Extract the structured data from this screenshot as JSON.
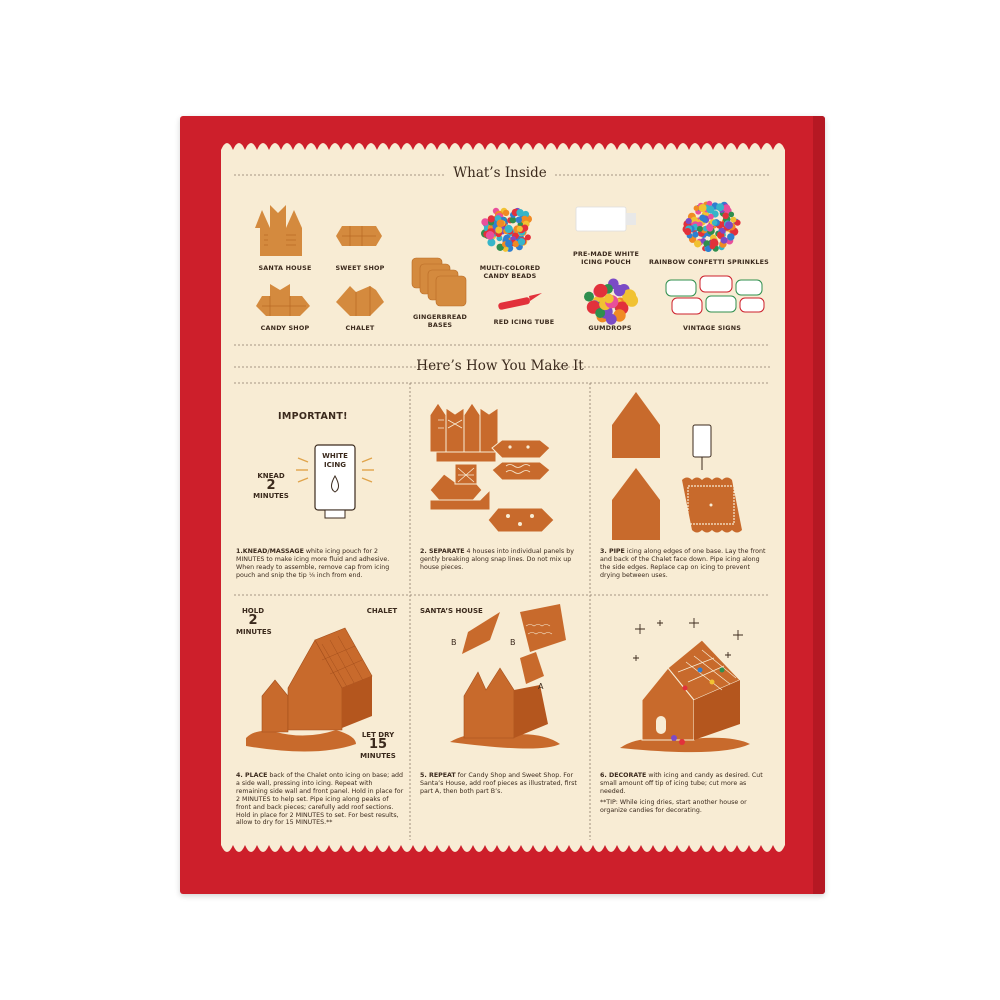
{
  "sections": {
    "inside_title": "What’s Inside",
    "make_title": "Here’s How You Make It"
  },
  "items": {
    "santa_house": "SANTA HOUSE",
    "sweet_shop": "SWEET SHOP",
    "candy_shop": "CANDY SHOP",
    "chalet": "CHALET",
    "bases": "GINGERBREAD BASES",
    "candy_beads": "MULTI-COLORED CANDY BEADS",
    "icing_tube": "RED ICING TUBE",
    "icing_pouch": "PRE-MADE WHITE ICING POUCH",
    "gumdrops": "GUMDROPS",
    "sprinkles": "RAINBOW CONFETTI SPRINKLES",
    "signs": "VINTAGE SIGNS"
  },
  "step1": {
    "important": "IMPORTANT!",
    "knead": "KNEAD",
    "knead_num": "2",
    "knead_unit": "MINUTES",
    "pouch_label": "WHITE ICING",
    "lead": "1.KNEAD/MASSAGE",
    "text": " white icing pouch for 2 MINUTES to make icing more fluid and adhesive. When ready to assemble, remove cap from icing pouch and snip the tip ⅛ inch from end."
  },
  "step2": {
    "lead": "2. SEPARATE",
    "text": " 4 houses into individual panels by gently breaking along snap lines. Do not mix up house pieces."
  },
  "step3": {
    "lead": "3. PIPE",
    "text": " icing along edges of one base. Lay the front and back of the Chalet face down. Pipe icing along the side edges. Replace cap on icing to prevent drying between uses."
  },
  "step4": {
    "hold": "HOLD",
    "hold_num": "2",
    "hold_unit": "MINUTES",
    "chalet": "CHALET",
    "letdry": "LET DRY",
    "dry_num": "15",
    "dry_unit": "MINUTES",
    "lead": "4. PLACE",
    "text": " back of the Chalet onto icing on base; add a side wall, pressing into icing. Repeat with remaining side wall and front panel. Hold in place for 2 MINUTES to help set. Pipe icing along peaks of front and back pieces; carefully add roof sections. Hold in place for 2 MINUTES to set. For best results, allow to dry for 15 MINUTES.**"
  },
  "step5": {
    "santa": "SANTA’S HOUSE",
    "b1": "B",
    "b2": "B",
    "a": "A",
    "lead": "5. REPEAT",
    "text": " for Candy Shop and Sweet Shop. For Santa’s House, add roof pieces as illustrated, first part A, then both part B’s."
  },
  "step6": {
    "lead": "6. DECORATE",
    "text": " with icing and candy as desired. Cut small amount off tip of icing tube; cut more as needed.",
    "tip": "**TIP: While icing dries, start another house or organize candies for decorating."
  },
  "colors": {
    "box_red": "#cd1f2b",
    "panel_cream": "#f8ecd4",
    "gingerbread": "#c86a2c",
    "gingerbread_dark": "#b4561e",
    "divider": "#8a7a68"
  }
}
